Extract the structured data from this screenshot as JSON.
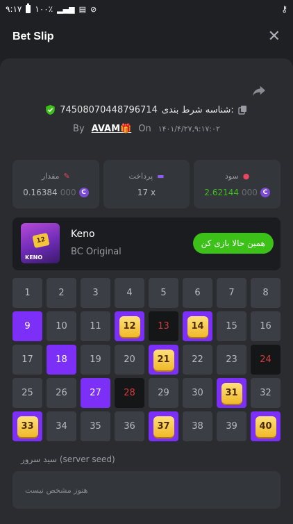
{
  "statusbar": {
    "time": "۹:۱۷",
    "battery": "۱۰۰٪"
  },
  "header": {
    "title": "Bet Slip",
    "close": "✕"
  },
  "bet": {
    "id_label": "شناسه شرط بندی:",
    "id": "74508070448796714",
    "by_label": "By",
    "user": "AVAM🎁",
    "on_label": "On",
    "date": "۱۴۰۱/۴/۲۷,۹:۱۷:۰۲"
  },
  "stats": [
    {
      "label": "مقدار",
      "value_main": "0.16384",
      "value_dim": "000",
      "color": "#b7b9be"
    },
    {
      "label": "پرداخت",
      "value_main": "17 x",
      "value_dim": "",
      "color": "#b7b9be"
    },
    {
      "label": "سود",
      "value_main": "2.62144",
      "value_dim": "000",
      "color": "#3bc117"
    }
  ],
  "game": {
    "name": "Keno",
    "subtitle": "BC Original",
    "play_label": "همین حالا بازی کن",
    "thumb_number": "12",
    "thumb_text": "KENO"
  },
  "grid": {
    "selected": [
      9,
      18,
      27
    ],
    "hits": [
      12,
      14,
      21,
      31,
      33,
      37,
      40
    ],
    "misses": [
      13,
      24,
      28
    ]
  },
  "seed": {
    "label": "سید سرور (server seed)",
    "value": "هنوز مشخص نیست"
  }
}
